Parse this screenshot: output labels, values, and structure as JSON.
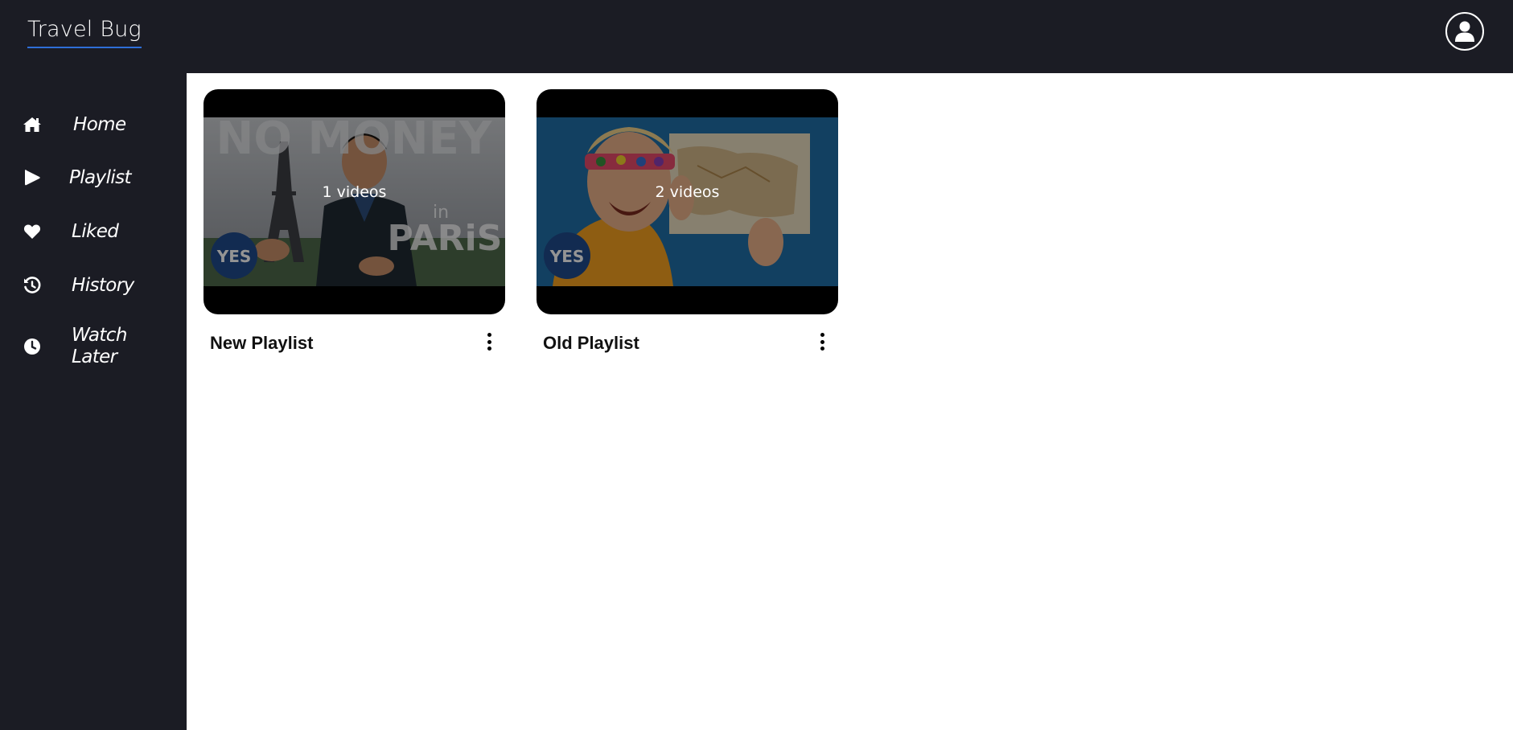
{
  "header": {
    "brand": "Travel Bug",
    "avatar_icon": "user-avatar-icon"
  },
  "sidebar": {
    "items": [
      {
        "label": "Home",
        "icon": "home-icon"
      },
      {
        "label": "Playlist",
        "icon": "play-icon"
      },
      {
        "label": "Liked",
        "icon": "heart-icon"
      },
      {
        "label": "History",
        "icon": "history-icon"
      },
      {
        "label": "Watch Later",
        "icon": "clock-icon"
      }
    ]
  },
  "playlists": [
    {
      "title": "New Playlist",
      "count_label": "1 videos",
      "thumbnail_text_top": "NO MONEY",
      "thumbnail_text_in": "in",
      "thumbnail_text_bottom": "PARiS",
      "thumbnail_badge": "YES"
    },
    {
      "title": "Old Playlist",
      "count_label": "2 videos",
      "thumbnail_badge": "YES"
    }
  ],
  "colors": {
    "chrome": "#1b1c24",
    "brand_underline": "#2e6fd8",
    "accent_orange": "#f4a020"
  }
}
